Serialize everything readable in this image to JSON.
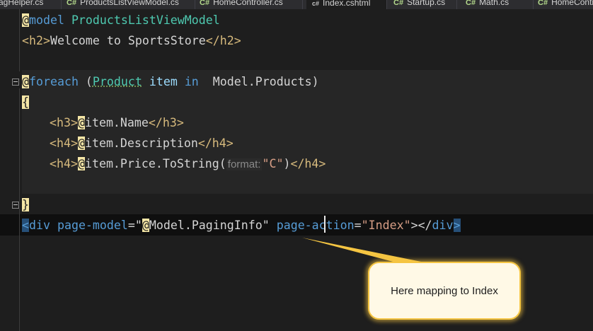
{
  "tabs": [
    {
      "lang": "",
      "label": "TagHelper.cs"
    },
    {
      "lang": "C#",
      "label": "ProductsListViewModel.cs"
    },
    {
      "lang": "C#",
      "label": "HomeController.cs"
    },
    {
      "lang": "c#",
      "label": "Index.cshtml"
    },
    {
      "lang": "C#",
      "label": "Startup.cs"
    },
    {
      "lang": "C#",
      "label": "Math.cs"
    },
    {
      "lang": "C#",
      "label": "HomeContr"
    }
  ],
  "code": {
    "l1": {
      "at": "@",
      "kw": "model",
      "type": " ProductsListViewModel"
    },
    "l2": {
      "open": "<h2>",
      "text": "Welcome to SportsStore",
      "close": "</h2>"
    },
    "l3": {
      "at": "@",
      "kw": "foreach",
      "p1": " (",
      "type": "Product",
      "var": " item ",
      "in": "in",
      "rest": "  Model.Products)"
    },
    "l4": {
      "brace": "{"
    },
    "l5": {
      "open": "<h3>",
      "at": "@",
      "expr": "item.Name",
      "close": "</h3>"
    },
    "l6": {
      "open": "<h4>",
      "at": "@",
      "expr": "item.Description",
      "close": "</h4>"
    },
    "l7": {
      "open": "<h4>",
      "at": "@",
      "expr": "item.Price.ToString(",
      "hint": "format:",
      "str": "\"C\"",
      "after": ")",
      "close": "</h4>"
    },
    "l8": {
      "brace": "}"
    },
    "l9": {
      "lt": "<",
      "tag": "div",
      "attr1": " page-model",
      "eq1": "=\"",
      "at": "@",
      "expr": "Model.PagingInfo",
      "q1": "\"",
      "attr2": " page-action",
      "eq2": "=",
      "val2": "\"Index\"",
      "gt": ">",
      "close": "</",
      "tag2": "div",
      "end": ">"
    }
  },
  "callout": {
    "text": "Here mapping to Index"
  },
  "colors": {
    "accent": "#f5c542",
    "background": "#1e1e1e"
  }
}
